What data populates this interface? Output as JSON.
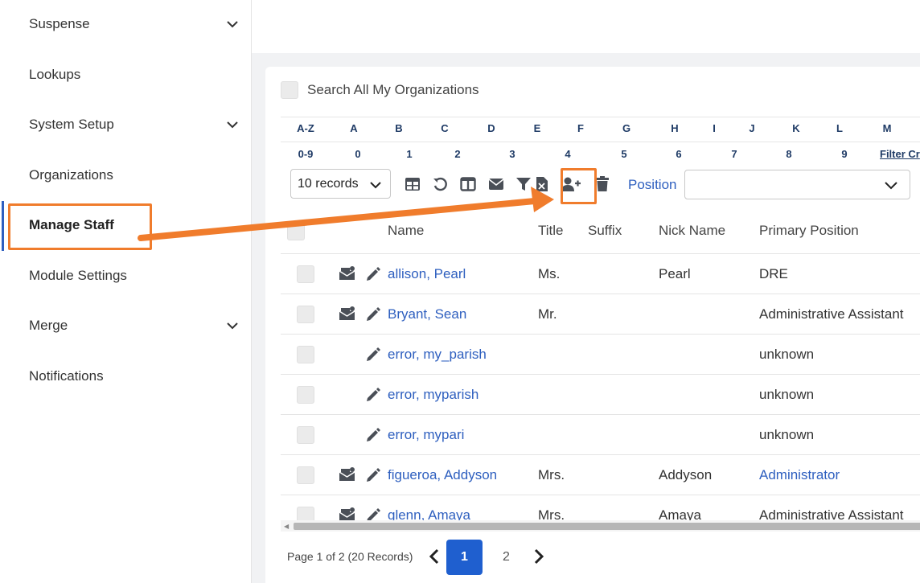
{
  "sidebar": {
    "items": [
      {
        "label": "Suspense",
        "has_chevron": true
      },
      {
        "label": "Lookups",
        "has_chevron": false
      },
      {
        "label": "System Setup",
        "has_chevron": true
      },
      {
        "label": "Organizations",
        "has_chevron": false
      },
      {
        "label": "Manage Staff",
        "has_chevron": false,
        "active": true
      },
      {
        "label": "Module Settings",
        "has_chevron": false
      },
      {
        "label": "Merge",
        "has_chevron": true
      },
      {
        "label": "Notifications",
        "has_chevron": false
      }
    ]
  },
  "search_all": {
    "label": "Search All My Organizations",
    "checked": false
  },
  "alpha_filter": {
    "letters": [
      "A-Z",
      "A",
      "B",
      "C",
      "D",
      "E",
      "F",
      "G",
      "H",
      "I",
      "J",
      "K",
      "L",
      "M"
    ],
    "digits": [
      "0-9",
      "0",
      "1",
      "2",
      "3",
      "4",
      "5",
      "6",
      "7",
      "8",
      "9"
    ],
    "filter_link": "Filter Cr"
  },
  "toolbar": {
    "records_select": "10 records",
    "icons": [
      "grid-view-icon",
      "undo-icon",
      "columns-icon",
      "email-icon",
      "filter-icon",
      "export-excel-icon",
      "add-user-icon",
      "trash-icon"
    ],
    "position_label": "Position",
    "position_value": ""
  },
  "grid": {
    "columns": [
      "Name",
      "Title",
      "Suffix",
      "Nick Name",
      "Primary Position"
    ],
    "rows": [
      {
        "name": "allison, Pearl",
        "title": "Ms.",
        "suffix": "",
        "nickname": "Pearl",
        "position": "DRE",
        "position_link": false,
        "staff_icon": true
      },
      {
        "name": "Bryant, Sean",
        "title": "Mr.",
        "suffix": "",
        "nickname": "",
        "position": "Administrative Assistant",
        "position_link": false,
        "staff_icon": true
      },
      {
        "name": "error, my_parish",
        "title": "",
        "suffix": "",
        "nickname": "",
        "position": "unknown",
        "position_link": false,
        "staff_icon": false
      },
      {
        "name": "error, myparish",
        "title": "",
        "suffix": "",
        "nickname": "",
        "position": "unknown",
        "position_link": false,
        "staff_icon": false
      },
      {
        "name": "error, mypari",
        "title": "",
        "suffix": "",
        "nickname": "",
        "position": "unknown",
        "position_link": false,
        "staff_icon": false
      },
      {
        "name": "figueroa, Addyson",
        "title": "Mrs.",
        "suffix": "",
        "nickname": "Addyson",
        "position": "Administrator",
        "position_link": true,
        "staff_icon": true
      },
      {
        "name": "glenn, Amaya",
        "title": "Mrs.",
        "suffix": "",
        "nickname": "Amaya",
        "position": "Administrative Assistant",
        "position_link": false,
        "staff_icon": true
      }
    ]
  },
  "pager": {
    "info": "Page 1 of 2 (20 Records)",
    "pages": [
      "1",
      "2"
    ],
    "current": "1"
  },
  "colors": {
    "accent_blue": "#2e5fbf",
    "highlight_orange": "#f07c2c",
    "active_page": "#1f5fcf"
  }
}
